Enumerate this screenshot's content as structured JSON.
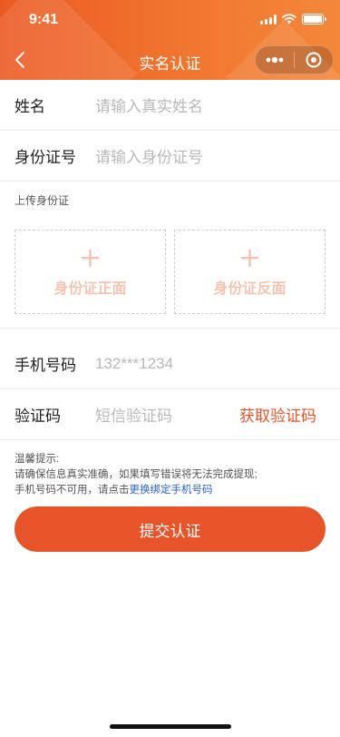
{
  "status_bar": {
    "time": "9:41"
  },
  "nav": {
    "title": "实名认证"
  },
  "form": {
    "name": {
      "label": "姓名",
      "placeholder": "请输入真实姓名"
    },
    "id_number": {
      "label": "身份证号",
      "placeholder": "请输入身份证号"
    },
    "upload": {
      "title": "上传身份证",
      "front": {
        "plus": "+",
        "label": "身份证正面"
      },
      "back": {
        "plus": "+",
        "label": "身份证反面"
      }
    },
    "phone": {
      "label": "手机号码",
      "value": "132***1234"
    },
    "code": {
      "label": "验证码",
      "placeholder": "短信验证码",
      "action": "获取验证码"
    }
  },
  "tips": {
    "title": "温馨提示:",
    "line1": "请确保信息真实准确，如果填写错误将无法完成提现;",
    "line2_prefix": "手机号码不可用，请点击",
    "line2_link": "更换绑定手机号码"
  },
  "submit": {
    "label": "提交认证"
  },
  "colors": {
    "accent": "#e8542a",
    "link": "#2a64c8",
    "header_start": "#ec5a24",
    "header_end": "#f4873a"
  },
  "icons": [
    "back-chevron-icon",
    "more-dots-icon",
    "close-circle-icon",
    "signal-icon",
    "wifi-icon",
    "battery-icon",
    "plus-icon"
  ]
}
